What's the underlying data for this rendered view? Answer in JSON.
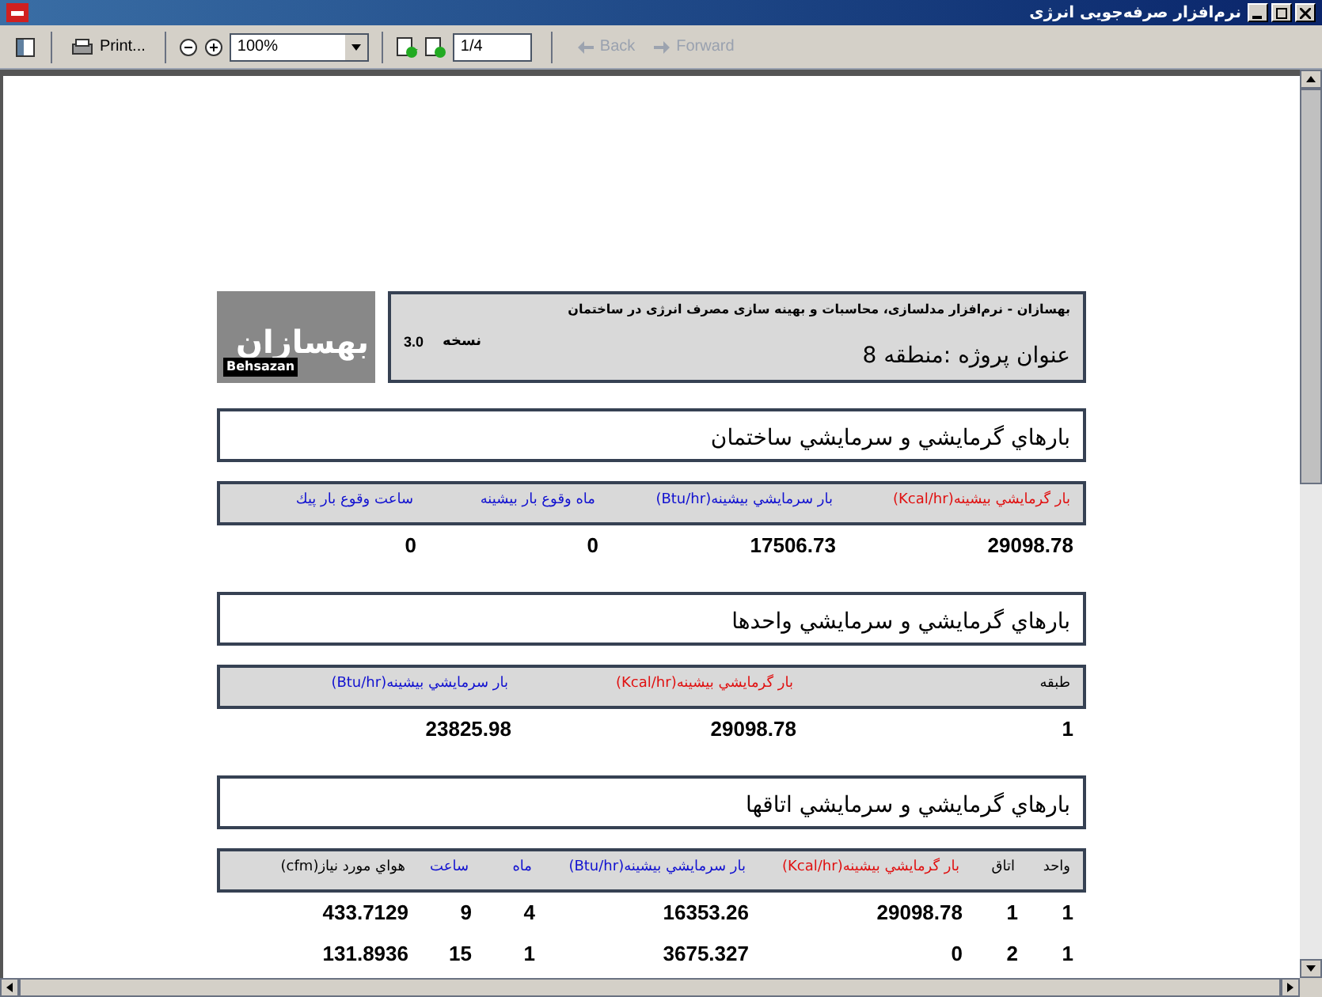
{
  "window": {
    "title": "نرم‌افزار صرفه‌جویی انرژی"
  },
  "toolbar": {
    "print": "Print...",
    "zoom": "100%",
    "page": "1/4",
    "back": {
      "label": "Back",
      "disabled": true
    },
    "forward": {
      "label": "Forward",
      "disabled": true
    }
  },
  "report": {
    "logo": {
      "mark": "بهسازان",
      "latin": "Behsazan"
    },
    "header": {
      "subtitle": "بهسازان - نرم‌افزار مدلسازی، محاسبات و بهینه سازی مصرف انرژی در ساختمان",
      "version_label": "نسخه",
      "version": "3.0",
      "project": "عنوان پروژه :منطقه 8"
    },
    "sections": [
      {
        "title": "بارهاي گرمايشي و سرمايشي ساختمان",
        "columns": [
          {
            "label": "بار گرمايشي بيشينه(Kcal/hr)",
            "color": "#e01010"
          },
          {
            "label": "بار سرمايشي بيشينه(Btu/hr)",
            "color": "#1010d0"
          },
          {
            "label": "ماه وقوع بار بيشينه",
            "color": "#1010d0"
          },
          {
            "label": "ساعت وقوع بار پيك",
            "color": "#1010d0"
          }
        ],
        "rows": [
          [
            "29098.78",
            "17506.73",
            "0",
            "0"
          ]
        ]
      },
      {
        "title": "بارهاي گرمايشي و سرمايشي واحدها",
        "columns": [
          {
            "label": "طبقه",
            "color": "#000000"
          },
          {
            "label": "بار گرمايشي بيشينه(Kcal/hr)",
            "color": "#e01010"
          },
          {
            "label": "بار سرمايشي بيشينه(Btu/hr)",
            "color": "#1010d0"
          }
        ],
        "rows": [
          [
            "1",
            "29098.78",
            "23825.98"
          ]
        ]
      },
      {
        "title": "بارهاي گرمايشي و سرمايشي اتاقها",
        "columns": [
          {
            "label": "واحد",
            "color": "#000000"
          },
          {
            "label": "اتاق",
            "color": "#000000"
          },
          {
            "label": "بار گرمايشي بيشينه(Kcal/hr)",
            "color": "#e01010"
          },
          {
            "label": "بار سرمايشي بيشينه(Btu/hr)",
            "color": "#1010d0"
          },
          {
            "label": "ماه",
            "color": "#1010d0"
          },
          {
            "label": "ساعت",
            "color": "#1010d0"
          },
          {
            "label": "هواي مورد نياز(cfm)",
            "color": "#000000"
          }
        ],
        "rows": [
          [
            "1",
            "1",
            "29098.78",
            "16353.26",
            "4",
            "9",
            "433.7129"
          ],
          [
            "1",
            "2",
            "0",
            "3675.327",
            "1",
            "15",
            "131.8936"
          ]
        ]
      }
    ]
  }
}
